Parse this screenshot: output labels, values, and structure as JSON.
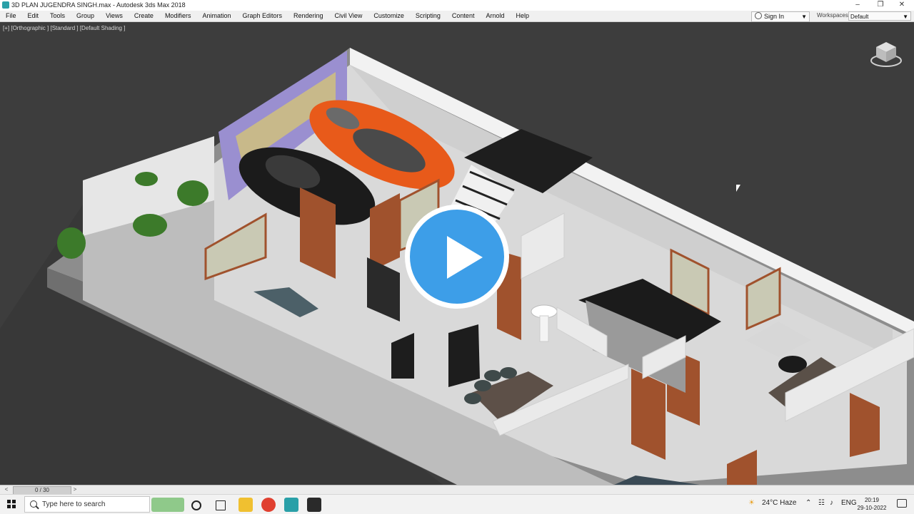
{
  "window": {
    "title": "3D PLAN JUGENDRA SINGH.max - Autodesk 3ds Max 2018",
    "minimize": "–",
    "maximize": "❐",
    "close": "✕"
  },
  "menu": {
    "items": [
      "File",
      "Edit",
      "Tools",
      "Group",
      "Views",
      "Create",
      "Modifiers",
      "Animation",
      "Graph Editors",
      "Rendering",
      "Civil View",
      "Customize",
      "Scripting",
      "Content",
      "Arnold",
      "Help"
    ]
  },
  "account": {
    "sign_in": "Sign In",
    "workspaces_label": "Workspaces:",
    "workspace_value": "Default"
  },
  "viewport": {
    "label": "[+] [Orthographic ] [Standard ] [Default Shading ]"
  },
  "timeline": {
    "frame": "0 / 30",
    "prev": "<",
    "next": ">"
  },
  "taskbar": {
    "search_placeholder": "Type here to search",
    "weather": "24°C  Haze",
    "language": "ENG",
    "time": "20:19",
    "date": "29-10-2022"
  },
  "colors": {
    "play_blue": "#3d9ee8",
    "car_orange": "#e85a1a",
    "door_wood": "#a0522d",
    "gate_purple": "#9a8fd0"
  }
}
